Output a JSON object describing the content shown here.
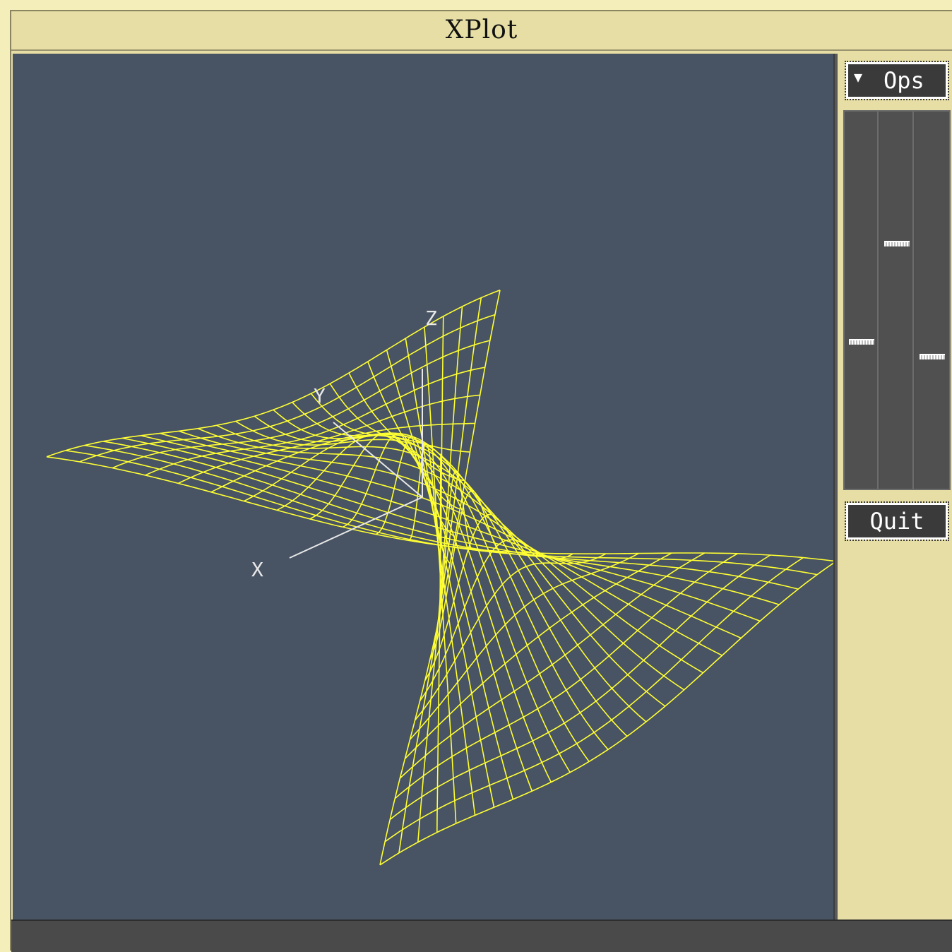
{
  "window": {
    "title": "XPlot"
  },
  "plot": {
    "background_color": "#485363",
    "mesh_color": "#ffff33",
    "axis_color": "#e8e8e8",
    "axes": {
      "x_label": "X",
      "y_label": "Y",
      "z_label": "Z"
    },
    "surface": {
      "grid_rows": 24,
      "grid_cols": 24,
      "x_range": [
        -1,
        1
      ],
      "y_range": [
        -1,
        1
      ],
      "z_range": [
        -0.9,
        1.05
      ]
    }
  },
  "side_panel": {
    "ops_button_label": "Ops",
    "ops_icon": "triangle-down-icon",
    "quit_button_label": "Quit",
    "sliders": [
      {
        "name": "rotation-x",
        "level": 0.61
      },
      {
        "name": "rotation-y",
        "level": 0.35
      },
      {
        "name": "rotation-z",
        "level": 0.65
      }
    ]
  }
}
